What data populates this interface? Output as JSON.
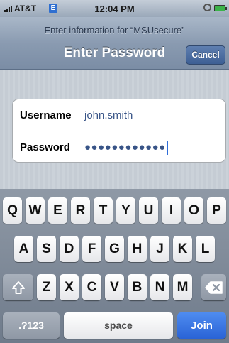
{
  "status_bar": {
    "carrier": "AT&T",
    "network": "E",
    "time": "12:04 PM",
    "signal_bars": 4,
    "battery_color": "#3bb24a"
  },
  "nav": {
    "prompt": "Enter information for “MSUsecure”",
    "title": "Enter Password",
    "cancel_label": "Cancel"
  },
  "form": {
    "username_label": "Username",
    "username_value": "john.smith",
    "password_label": "Password",
    "password_mask": "●●●●●●●●●●●●"
  },
  "keyboard": {
    "row1": [
      "Q",
      "W",
      "E",
      "R",
      "T",
      "Y",
      "U",
      "I",
      "O",
      "P"
    ],
    "row2": [
      "A",
      "S",
      "D",
      "F",
      "G",
      "H",
      "J",
      "K",
      "L"
    ],
    "row3": [
      "Z",
      "X",
      "C",
      "V",
      "B",
      "N",
      "M"
    ],
    "shift_icon": "shift-arrow-icon",
    "delete_icon": "backspace-icon",
    "mode_label": ".?123",
    "space_label": "space",
    "join_label": "Join",
    "accent_color": "#2a63d6"
  }
}
